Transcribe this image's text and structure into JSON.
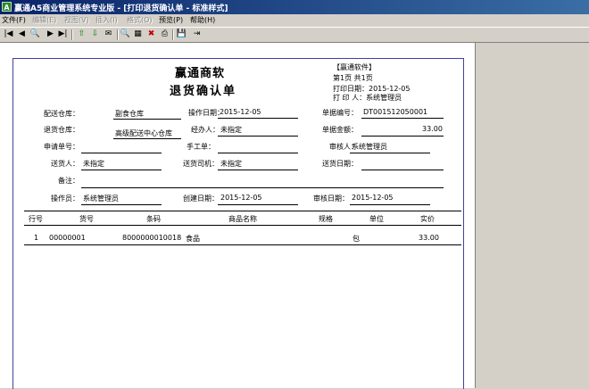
{
  "window": {
    "title": "赢通A5商业管理系统专业版 - [打印退货确认单 - 标准样式]"
  },
  "menu": [
    {
      "label": "文件(F)",
      "enabled": true
    },
    {
      "label": "编辑(E)",
      "enabled": false
    },
    {
      "label": "视图(V)",
      "enabled": false
    },
    {
      "label": "插入(I)",
      "enabled": false
    },
    {
      "label": "格式(O)",
      "enabled": false
    },
    {
      "label": "预览(P)",
      "enabled": true
    },
    {
      "label": "帮助(H)",
      "enabled": true
    }
  ],
  "toolbar": {
    "buttons": [
      {
        "name": "first-page-button",
        "icon": "|◀"
      },
      {
        "name": "prev-page-button",
        "icon": "◀"
      },
      {
        "name": "zoom-button",
        "icon": "🔍"
      },
      {
        "name": "next-page-button",
        "icon": "▶"
      },
      {
        "name": "last-page-button",
        "icon": "▶|"
      },
      {
        "name": "move-up-button",
        "icon": "⇧"
      },
      {
        "name": "move-down-button",
        "icon": "⇩"
      },
      {
        "name": "email-button",
        "icon": "✉"
      },
      {
        "name": "search-button",
        "icon": "🔍"
      },
      {
        "name": "design-button",
        "icon": "▦"
      },
      {
        "name": "delete-button",
        "icon": "✖"
      },
      {
        "name": "print-button",
        "icon": "⎙"
      },
      {
        "name": "save-button",
        "icon": "💾"
      },
      {
        "name": "exit-button",
        "icon": "⇥"
      }
    ]
  },
  "report": {
    "company": "赢通商软",
    "title": "退货确认单",
    "header_right": {
      "software": "【赢通软件】",
      "page": "第1页 共1页",
      "print_date": "打印日期：2015-12-05",
      "printer": "打 印 人：系统管理员"
    },
    "fields": {
      "delivery_warehouse_label": "配送仓库：",
      "delivery_warehouse": "副食仓库",
      "op_date_label": "操作日期：",
      "op_date": "2015-12-05",
      "doc_no_label": "单据编号：",
      "doc_no": "DT001512050001",
      "return_warehouse_label": "退货仓库：",
      "return_warehouse": "高级配送中心仓库",
      "handler_label": "经办人：",
      "handler": "未指定",
      "doc_amount_label": "单据金额：",
      "doc_amount": "33.00",
      "request_no_label": "申请单号：",
      "request_no": "",
      "manual_no_label": "手工单：",
      "manual_no": "",
      "reviewer_label": "审核人：",
      "reviewer": "系统管理员",
      "deliverer_label": "送货人：",
      "deliverer": "未指定",
      "driver_label": "送货司机：",
      "driver": "未指定",
      "delivery_date_label": "送货日期：",
      "delivery_date": "",
      "remark_label": "备注：",
      "remark": "",
      "operator_label": "操作员：",
      "operator": "系统管理员",
      "create_date_label": "创建日期：",
      "create_date": "2015-12-05",
      "review_date_label": "审核日期：",
      "review_date": "2015-12-05"
    },
    "table": {
      "headers": [
        "行号",
        "货号",
        "条码",
        "商品名称",
        "规格",
        "单位",
        "实价"
      ],
      "rows": [
        [
          "1",
          "00000001",
          "8000000010018",
          "食品",
          "",
          "包",
          "33.00"
        ]
      ]
    }
  }
}
